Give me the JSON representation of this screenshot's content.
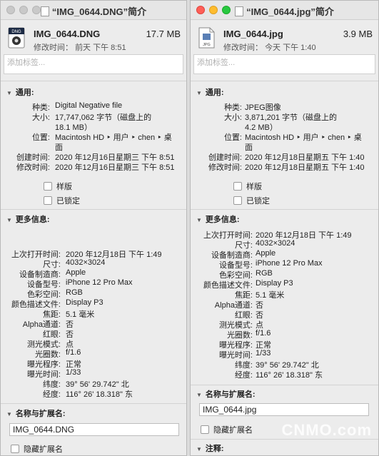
{
  "left": {
    "title": "“IMG_0644.DNG”简介",
    "filename": "IMG_0644.DNG",
    "size": "17.7 MB",
    "modified_label": "修改时间：",
    "modified_value": "前天 下午 8:51",
    "tags_placeholder": "添加标签...",
    "general_label": "通用:",
    "general": [
      {
        "key": "种类:",
        "value": "Digital Negative file"
      },
      {
        "key": "大小:",
        "value": "17,747,062 字节（磁盘上的"
      },
      {
        "key": "",
        "value": "18.1 MB）"
      },
      {
        "key": "位置:",
        "value": "Macintosh HD ‣ 用户 ‣ chen ‣ 桌"
      },
      {
        "key": "",
        "value": "面"
      },
      {
        "key": "创建时间:",
        "value": "2020 年12月16日星期三 下午 8:51"
      },
      {
        "key": "修改时间:",
        "value": "2020 年12月16日星期三 下午 8:51"
      }
    ],
    "stationery_label": "样版",
    "locked_label": "已锁定",
    "more_label": "更多信息:",
    "more": [
      {
        "key": "上次打开时间:",
        "value": "2020 年12月18日 下午 1:49"
      },
      {
        "key": "尺寸:",
        "value": "4032×3024"
      },
      {
        "key": "设备制造商:",
        "value": "Apple"
      },
      {
        "key": "设备型号:",
        "value": "iPhone 12 Pro Max"
      },
      {
        "key": "色彩空间:",
        "value": "RGB"
      },
      {
        "key": "颜色描述文件:",
        "value": "Display P3"
      },
      {
        "key": "焦距:",
        "value": "5.1 毫米"
      },
      {
        "key": "Alpha通道:",
        "value": "否"
      },
      {
        "key": "红眼:",
        "value": "否"
      },
      {
        "key": "测光模式:",
        "value": "点"
      },
      {
        "key": "光圈数:",
        "value": "f/1.6"
      },
      {
        "key": "曝光程序:",
        "value": "正常"
      },
      {
        "key": "曝光时间:",
        "value": "1/33"
      },
      {
        "key": "纬度:",
        "value": "39° 56' 29.742\" 北"
      },
      {
        "key": "经度:",
        "value": "116° 26' 18.318\" 东"
      }
    ],
    "name_ext_label": "名称与扩展名:",
    "name_value": "IMG_0644.DNG",
    "hide_ext_label": "隐藏扩展名"
  },
  "right": {
    "title": "“IMG_0644.jpg”简介",
    "filename": "IMG_0644.jpg",
    "size": "3.9 MB",
    "modified_label": "修改时间：",
    "modified_value": "今天 下午 1:40",
    "tags_placeholder": "添加标签...",
    "general_label": "通用:",
    "general": [
      {
        "key": "种类:",
        "value": "JPEG图像"
      },
      {
        "key": "大小:",
        "value": "3,871,201 字节（磁盘上的"
      },
      {
        "key": "",
        "value": "4.2 MB）"
      },
      {
        "key": "位置:",
        "value": "Macintosh HD ‣ 用户 ‣ chen ‣ 桌"
      },
      {
        "key": "",
        "value": "面"
      },
      {
        "key": "创建时间:",
        "value": "2020 年12月18日星期五 下午 1:40"
      },
      {
        "key": "修改时间:",
        "value": "2020 年12月18日星期五 下午 1:40"
      }
    ],
    "stationery_label": "样版",
    "locked_label": "已锁定",
    "more_label": "更多信息:",
    "more": [
      {
        "key": "上次打开时间:",
        "value": "2020 年12月18日 下午 1:49"
      },
      {
        "key": "尺寸:",
        "value": "4032×3024"
      },
      {
        "key": "设备制造商:",
        "value": "Apple"
      },
      {
        "key": "设备型号:",
        "value": "iPhone 12 Pro Max"
      },
      {
        "key": "色彩空间:",
        "value": "RGB"
      },
      {
        "key": "颜色描述文件:",
        "value": "Display P3"
      },
      {
        "key": "焦距:",
        "value": "5.1 毫米"
      },
      {
        "key": "Alpha通道:",
        "value": "否"
      },
      {
        "key": "红眼:",
        "value": "否"
      },
      {
        "key": "测光模式:",
        "value": "点"
      },
      {
        "key": "光圈数:",
        "value": "f/1.6"
      },
      {
        "key": "曝光程序:",
        "value": "正常"
      },
      {
        "key": "曝光时间:",
        "value": "1/33"
      },
      {
        "key": "纬度:",
        "value": "39° 56' 29.742\" 北"
      },
      {
        "key": "经度:",
        "value": "116° 26' 18.318\" 东"
      }
    ],
    "name_ext_label": "名称与扩展名:",
    "name_value": "IMG_0644.jpg",
    "hide_ext_label": "隐藏扩展名",
    "comments_label": "注释:"
  },
  "watermark": "CNMO.com"
}
